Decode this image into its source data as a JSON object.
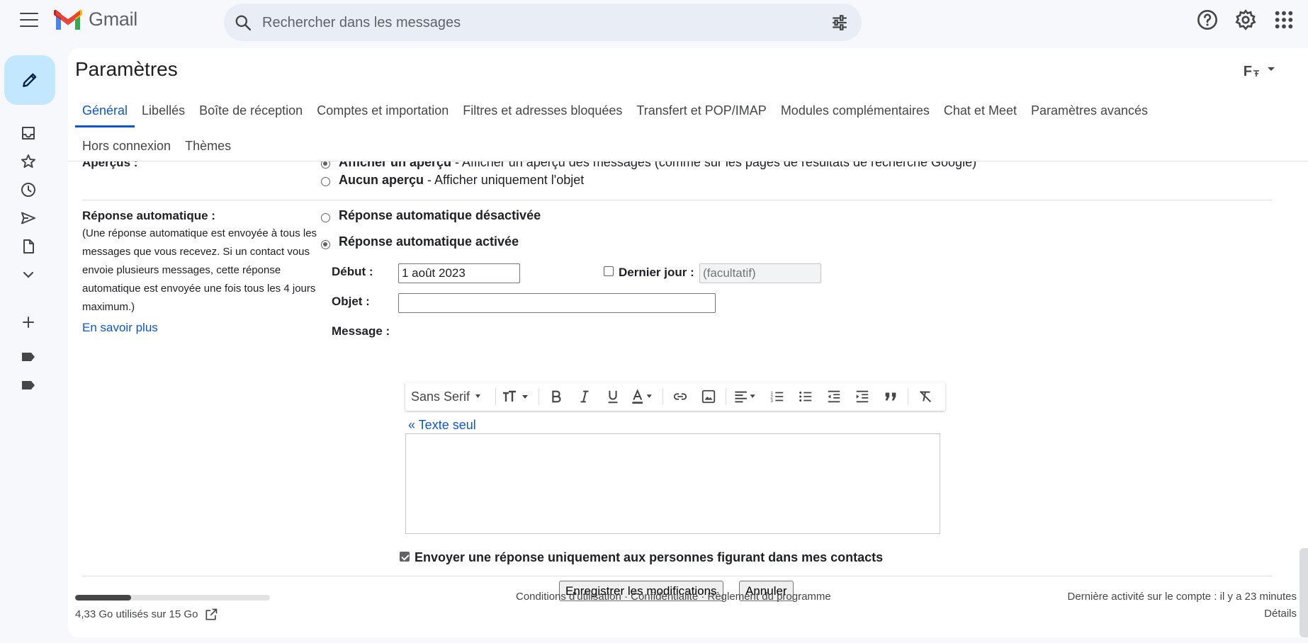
{
  "app": {
    "name": "Gmail",
    "brand_red": "#ea4335",
    "accent": "#0b57d0"
  },
  "search": {
    "placeholder": "Rechercher dans les messages"
  },
  "rail": {
    "icons": [
      "inbox-icon",
      "star-icon",
      "clock-icon",
      "send-icon",
      "draft-icon",
      "chevron-down-icon",
      "plus-icon",
      "label-icon",
      "label-icon"
    ]
  },
  "settings": {
    "title": "Paramètres",
    "density_label": "F",
    "tabs": [
      {
        "label": "Général",
        "active": true
      },
      {
        "label": "Libellés"
      },
      {
        "label": "Boîte de réception"
      },
      {
        "label": "Comptes et importation"
      },
      {
        "label": "Filtres et adresses bloquées"
      },
      {
        "label": "Transfert et POP/IMAP"
      },
      {
        "label": "Modules complémentaires"
      },
      {
        "label": "Chat et Meet"
      },
      {
        "label": "Paramètres avancés"
      }
    ],
    "tabs_row2": [
      {
        "label": "Hors connexion"
      },
      {
        "label": "Thèmes"
      }
    ]
  },
  "previews": {
    "label": "Aperçus :",
    "opt1_bold": "Afficher un aperçu",
    "opt1_rest": " - Afficher un aperçu des messages (comme sur les pages de résultats de recherche Google)",
    "opt2_bold": "Aucun aperçu",
    "opt2_rest": " - Afficher uniquement l'objet",
    "selected": "opt1"
  },
  "autoreply": {
    "label": "Réponse automatique :",
    "hint": "(Une réponse automatique est envoyée à tous les messages que vous recevez. Si un contact vous envoie plusieurs messages, cette réponse automatique est envoyée une fois tous les 4 jours maximum.)",
    "learn_more": "En savoir plus",
    "off_label": "Réponse automatique désactivée",
    "on_label": "Réponse automatique activée",
    "selected": "on",
    "start_label": "Début :",
    "start_value": "1 août 2023",
    "last_day_label": "Dernier jour :",
    "last_day_checked": false,
    "last_day_placeholder": "(facultatif)",
    "subject_label": "Objet :",
    "subject_value": "",
    "message_label": "Message :",
    "toolbar": {
      "font": "Sans Serif",
      "icons": [
        "font-size-icon",
        "bold-icon",
        "italic-icon",
        "underline-icon",
        "text-color-icon",
        "link-icon",
        "image-icon",
        "align-icon",
        "numbered-list-icon",
        "bulleted-list-icon",
        "indent-less-icon",
        "indent-more-icon",
        "quote-icon",
        "remove-formatting-icon"
      ]
    },
    "plain_text_link": "« Texte seul",
    "contacts_only_label": "Envoyer une réponse uniquement aux personnes figurant dans mes contacts",
    "contacts_only_checked": true
  },
  "buttons": {
    "save": "Enregistrer les modifications",
    "cancel": "Annuler"
  },
  "footer": {
    "storage_text": "4,33 Go utilisés sur 15 Go",
    "storage_used_fraction": 0.289,
    "links": "Conditions d'utilisation · Confidentialité · Règlement du programme",
    "last_activity": "Dernière activité sur le compte : il y a 23 minutes",
    "details": "Détails"
  }
}
